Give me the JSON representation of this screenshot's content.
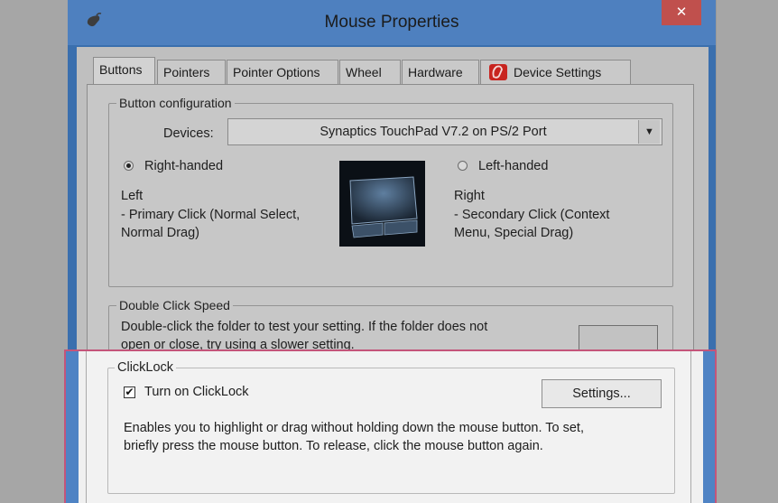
{
  "window": {
    "title": "Mouse Properties",
    "close_label": "✕"
  },
  "tabs": [
    {
      "label": "Buttons"
    },
    {
      "label": "Pointers"
    },
    {
      "label": "Pointer Options"
    },
    {
      "label": "Wheel"
    },
    {
      "label": "Hardware"
    },
    {
      "label": "Device Settings"
    }
  ],
  "button_config": {
    "legend": "Button configuration",
    "devices_label": "Devices:",
    "devices_value": "Synaptics TouchPad V7.2 on PS/2 Port",
    "right_handed_label": "Right-handed",
    "left_handed_label": "Left-handed",
    "left_title": "Left",
    "left_line1": " - Primary Click (Normal Select,",
    "left_line2": "Normal Drag)",
    "right_title": "Right",
    "right_line1": " - Secondary Click (Context",
    "right_line2": "Menu, Special Drag)",
    "selected": "Right-handed"
  },
  "double_click": {
    "legend": "Double Click Speed",
    "line1": "Double-click the folder to test your setting.  If the folder does not",
    "line2": "open or close, try using a slower setting."
  },
  "clicklock": {
    "legend": "ClickLock",
    "checkbox_label": "Turn on ClickLock",
    "checked": true,
    "settings_button": "Settings...",
    "desc_line1": "Enables you to highlight or drag without holding down the mouse button.  To set,",
    "desc_line2": "briefly press the mouse button.  To release, click the mouse button again."
  },
  "colors": {
    "highlight_border": "#c4557a",
    "titlebar": "#4e80bf",
    "close": "#c0504d"
  },
  "icons": {
    "app": "mouse-icon",
    "device_settings": "synaptics-icon"
  }
}
